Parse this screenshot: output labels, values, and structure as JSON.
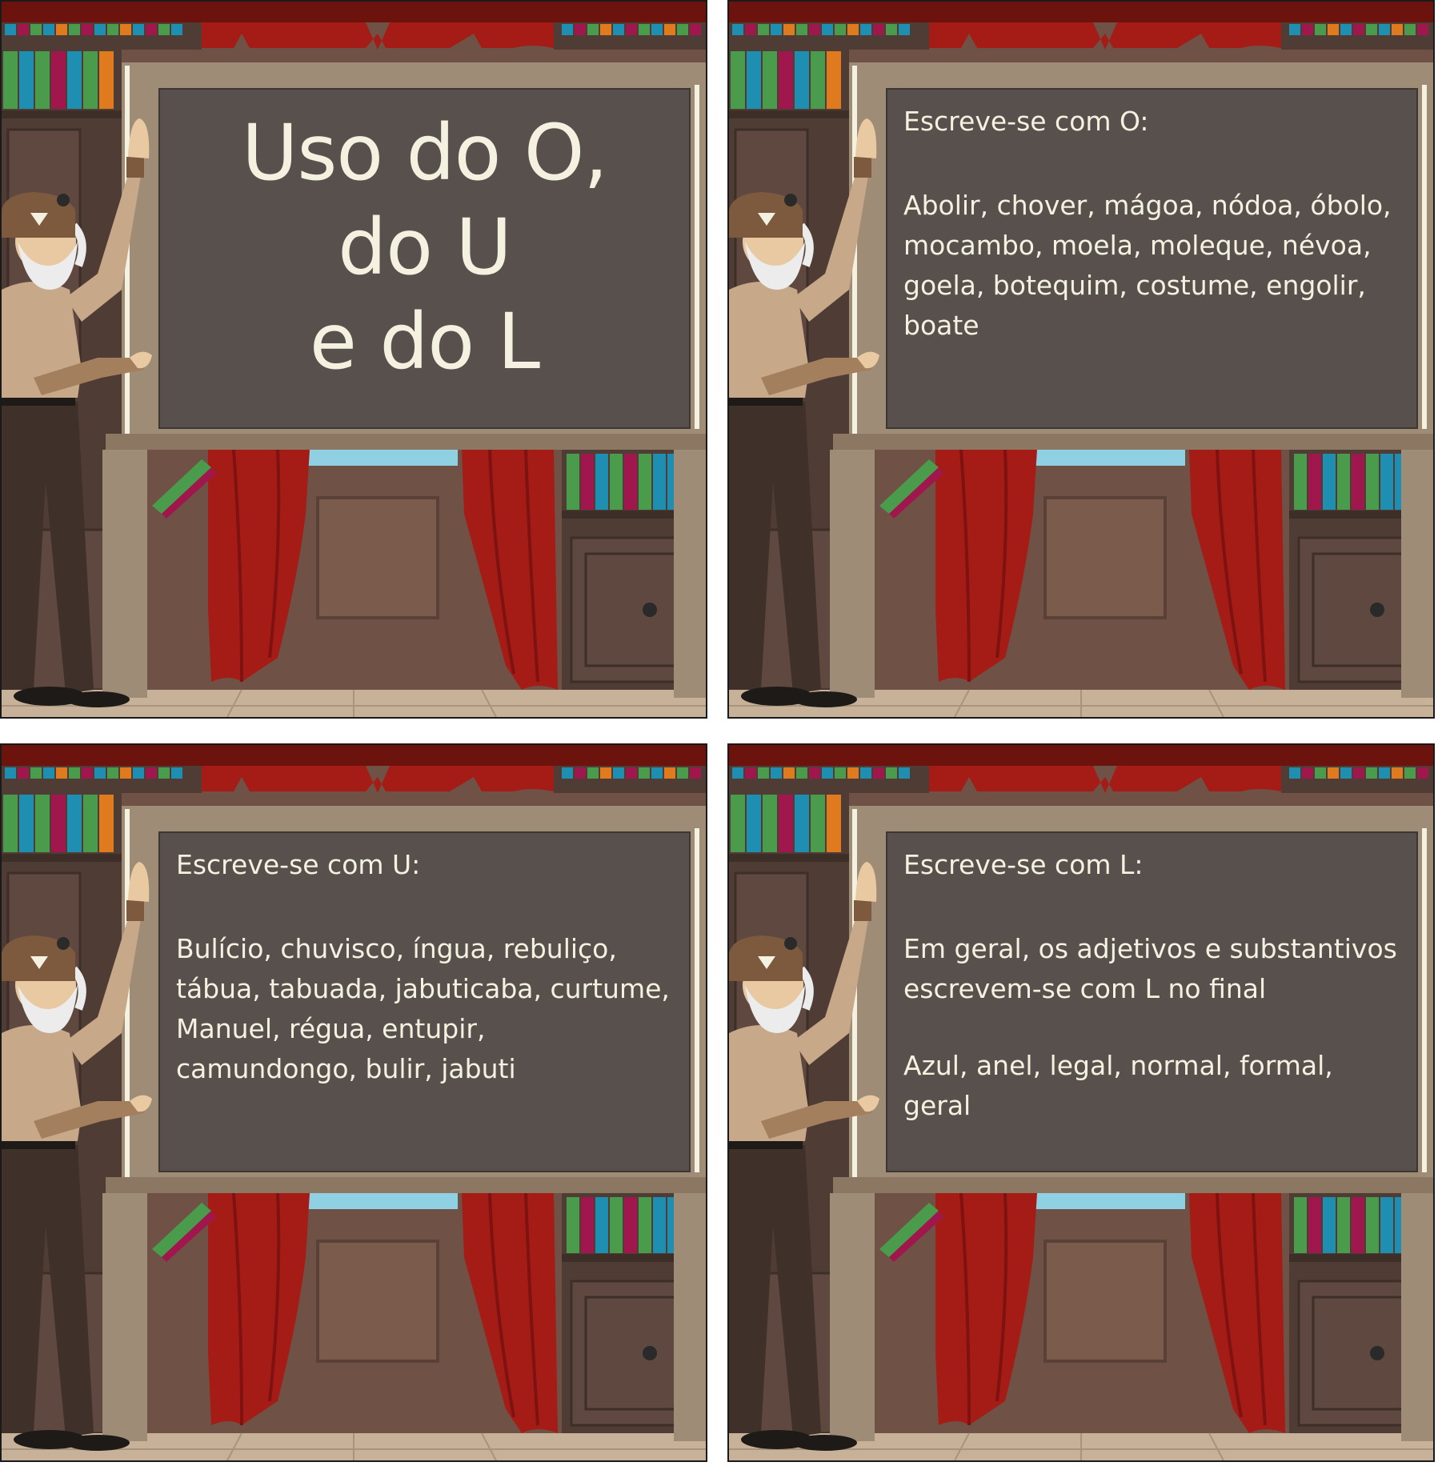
{
  "panels": [
    {
      "title": "Uso do O,\ndo U\ne do L"
    },
    {
      "heading": "Escreve-se com O:",
      "text": "Abolir, chover, mágoa, nódoa, óbolo, mocambo, moela, moleque, névoa, goela, botequim, costume, engolir, boate"
    },
    {
      "heading": "Escreve-se com U:",
      "text": "Bulício, chuvisco, íngua, rebuliço, tábua, tabuada, jabuticaba, curtume, Manuel, régua, entupir, camundongo, bulir, jabuti"
    },
    {
      "heading": "Escreve-se com L:",
      "text": "Em geral, os adjetivos e substantivos escrevem-se com L no final",
      "examples": "Azul, anel, legal, normal, formal, geral"
    }
  ],
  "colors": {
    "chalkboard": "#57504d",
    "chalk": "#f4f1e1",
    "frame": "#9f8c77",
    "curtain": "#a51c17",
    "shelf": "#4f3c35"
  },
  "icons": [
    "teacher-character",
    "bookshelf",
    "curtain",
    "window",
    "cabinet-door",
    "chalkboard"
  ]
}
